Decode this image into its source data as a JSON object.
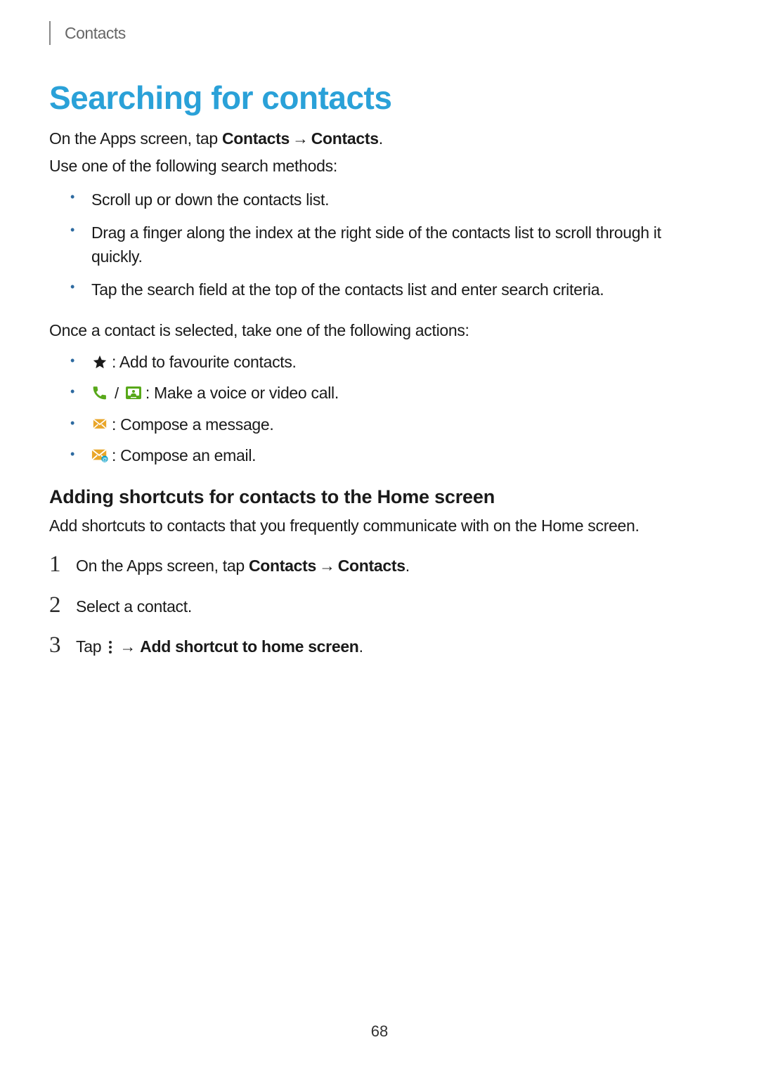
{
  "header": "Contacts",
  "title": "Searching for contacts",
  "intro1_pre": "On the Apps screen, tap ",
  "intro1_b1": "Contacts",
  "intro1_arrow": "→",
  "intro1_b2": "Contacts",
  "intro1_post": ".",
  "intro2": "Use one of the following search methods:",
  "bullets": [
    "Scroll up or down the contacts list.",
    "Drag a finger along the index at the right side of the contacts list to scroll through it quickly.",
    "Tap the search field at the top of the contacts list and enter search criteria."
  ],
  "once": "Once a contact is selected, take one of the following actions:",
  "icon_bullets": {
    "star": " : Add to favourite contacts.",
    "call_sep": "/",
    "call": " : Make a voice or video call.",
    "msg": " : Compose a message.",
    "email": " : Compose an email."
  },
  "subhead": "Adding shortcuts for contacts to the Home screen",
  "subintro": "Add shortcuts to contacts that you frequently communicate with on the Home screen.",
  "steps": {
    "n1": "1",
    "s1_pre": "On the Apps screen, tap ",
    "s1_b1": "Contacts",
    "s1_arrow": "→",
    "s1_b2": "Contacts",
    "s1_post": ".",
    "n2": "2",
    "s2": "Select a contact.",
    "n3": "3",
    "s3_pre": "Tap ",
    "s3_arrow": " → ",
    "s3_b": "Add shortcut to home screen",
    "s3_post": "."
  },
  "page_number": "68"
}
